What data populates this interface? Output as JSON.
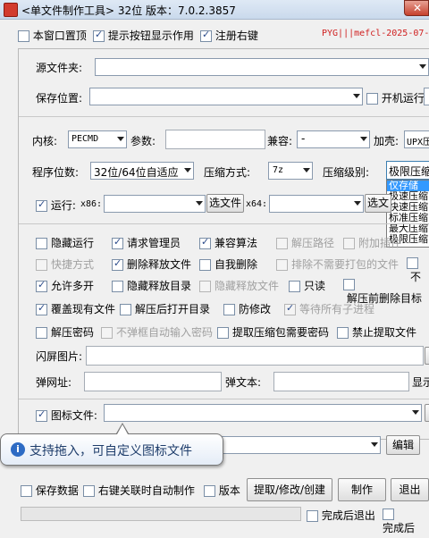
{
  "window": {
    "title": "<单文件制作工具> 32位 版本：7.0.2.3857"
  },
  "top_options": [
    {
      "label": "本窗口置顶",
      "checked": false
    },
    {
      "label": "提示按钮显示作用",
      "checked": true
    },
    {
      "label": "注册右键",
      "checked": true
    }
  ],
  "watermark": "PYG|||mefcl-2025-07-",
  "source": {
    "label": "源文件夹:",
    "value": ""
  },
  "save": {
    "label": "保存位置:",
    "value": "",
    "startup_label": "开机运行",
    "startup_checked": false
  },
  "kernel": {
    "label": "内核:",
    "value": "PECMD"
  },
  "params": {
    "label": "参数:",
    "value": ""
  },
  "compat": {
    "label": "兼容:",
    "value": "-"
  },
  "shell": {
    "label": "加壳:",
    "value": "UPX压"
  },
  "bits": {
    "label": "程序位数:",
    "value": "32位/64位自适应"
  },
  "compress_method": {
    "label": "压缩方式:",
    "value": "7z"
  },
  "compress_level": {
    "label": "压缩级别:",
    "value": "极限压缩",
    "options": [
      "仅存储",
      "极速压缩",
      "快速压缩",
      "标准压缩",
      "最大压缩",
      "极限压缩"
    ],
    "selected_index": 0
  },
  "run": {
    "label": "运行:",
    "checked": true,
    "x86_label": "x86:",
    "x86_value": "",
    "select_file_label": "选文件",
    "x64_label": "x64:",
    "x64_value": "",
    "select_file2_label": "选文"
  },
  "options_grid": [
    [
      {
        "label": "隐藏运行",
        "checked": false,
        "disabled": false
      },
      {
        "label": "请求管理员",
        "checked": true,
        "disabled": false
      },
      {
        "label": "兼容算法",
        "checked": true,
        "disabled": false
      },
      {
        "label": "解压路径",
        "checked": false,
        "disabled": true
      },
      {
        "label": "附加插件",
        "checked": false,
        "disabled": true
      }
    ],
    [
      {
        "label": "快捷方式",
        "checked": false,
        "disabled": true
      },
      {
        "label": "删除释放文件",
        "checked": true,
        "disabled": false
      },
      {
        "label": "自我删除",
        "checked": false,
        "disabled": false
      },
      {
        "label": "排除不需要打包的文件",
        "checked": false,
        "disabled": true
      },
      {
        "label": "不",
        "checked": false,
        "disabled": false
      }
    ],
    [
      {
        "label": "允许多开",
        "checked": true,
        "disabled": false
      },
      {
        "label": "隐藏释放目录",
        "checked": false,
        "disabled": false
      },
      {
        "label": "隐藏释放文件",
        "checked": false,
        "disabled": true
      },
      {
        "label": "只读",
        "checked": false,
        "disabled": false
      },
      {
        "label": "解压前删除目标",
        "checked": false,
        "disabled": false
      }
    ],
    [
      {
        "label": "覆盖现有文件",
        "checked": true,
        "disabled": false
      },
      {
        "label": "解压后打开目录",
        "checked": false,
        "disabled": false
      },
      {
        "label": "防修改",
        "checked": false,
        "disabled": false
      },
      {
        "label": "等待所有子进程",
        "checked": true,
        "disabled": true
      }
    ],
    [
      {
        "label": "解压密码",
        "checked": false,
        "disabled": false
      },
      {
        "label": "不弹框自动输入密码",
        "checked": false,
        "disabled": true
      },
      {
        "label": "提取压缩包需要密码",
        "checked": false,
        "disabled": false
      },
      {
        "label": "禁止提取文件",
        "checked": false,
        "disabled": false
      }
    ]
  ],
  "splash": {
    "label": "闪屏图片:",
    "value": ""
  },
  "popup_url": {
    "label": "弹网址:",
    "value": ""
  },
  "popup_text": {
    "label": "弹文本:",
    "value": "",
    "show_label": "显示"
  },
  "icon_file": {
    "label": "图标文件:",
    "checked": true,
    "value": ""
  },
  "tooltip": {
    "text": "支持拖入，可自定义图标文件"
  },
  "edit_button": "编辑",
  "bottom": {
    "save_data": {
      "label": "保存数据",
      "checked": false
    },
    "right_click_auto": {
      "label": "右键关联时自动制作",
      "checked": false
    },
    "version": {
      "label": "版本",
      "checked": false
    },
    "extract_label": "提取/修改/创建",
    "make_label": "制作",
    "exit_label": "退出",
    "exit_after_label": "完成后退出",
    "exit_after_checked": false,
    "done_after_label": "完成后",
    "done_after_checked": false
  }
}
